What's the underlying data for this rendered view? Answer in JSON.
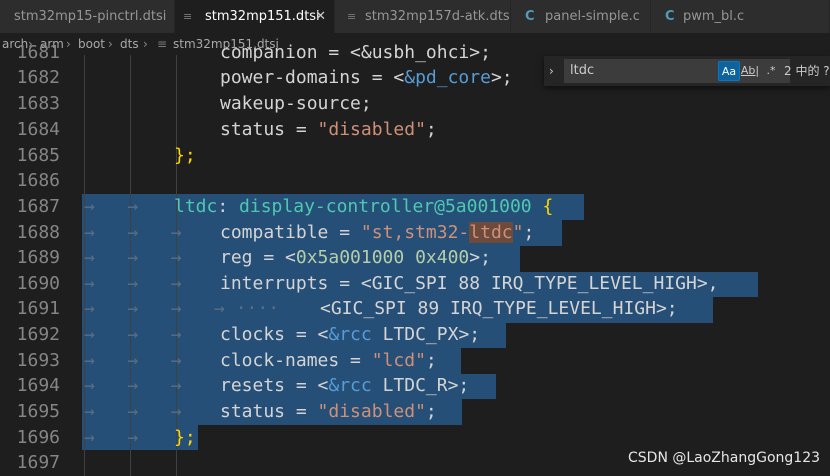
{
  "tabs": [
    {
      "label": "stm32mp15-pinctrl.dtsi",
      "icon": "file-icon",
      "active": false
    },
    {
      "label": "stm32mp151.dtsi",
      "icon": "file-icon",
      "active": true
    },
    {
      "label": "stm32mp157d-atk.dts",
      "icon": "file-icon",
      "active": false
    },
    {
      "label": "panel-simple.c",
      "icon": "c-file-icon",
      "active": false
    },
    {
      "label": "pwm_bl.c",
      "icon": "c-file-icon",
      "active": false
    }
  ],
  "breadcrumb": [
    "arch",
    "arm",
    "boot",
    "dts",
    "stm32mp151.dtsi"
  ],
  "find": {
    "query": "ltdc",
    "match_case": "Aa",
    "whole_word": "Ab|",
    "regex": ".*",
    "result": "2 中的 ?"
  },
  "watermark": "CSDN @LaoZhangGong123",
  "editor": {
    "line_numbers": [
      "1681",
      "1682",
      "1683",
      "1684",
      "1685",
      "1686",
      "1687",
      "1688",
      "1689",
      "1690",
      "1691",
      "1692",
      "1693",
      "1694",
      "1695",
      "1696",
      "1697"
    ],
    "line1681": "companion = <&usbh_ohci>;",
    "line1682": {
      "key": "power-domains = <",
      "ref": "&pd_core",
      "end": ">;"
    },
    "line1683": "wakeup-source;",
    "line1684": {
      "key": "status = ",
      "val": "\"disabled\"",
      "end": ";"
    },
    "line1685": "};",
    "line1687": {
      "label": "ltdc",
      "colon": ": ",
      "node": "display-controller@5a001000",
      "brace": "{"
    },
    "line1688": {
      "key": "compatible = ",
      "v1": "\"st,stm32-",
      "v2": "ltdc",
      "v3": "\"",
      "end": ";"
    },
    "line1689": {
      "key": "reg = <",
      "n1": "0x5a001000",
      "sp": " ",
      "n2": "0x400",
      "end": ">;"
    },
    "line1690": {
      "key": "interrupts = <",
      "p": "GIC_SPI 88 IRQ_TYPE_LEVEL_HIGH",
      "end": ">,"
    },
    "line1691": {
      "key": "<",
      "p": "GIC_SPI 89 IRQ_TYPE_LEVEL_HIGH",
      "end": ">;"
    },
    "line1692": {
      "key": "clocks = <",
      "ref": "&rcc",
      "p": " LTDC_PX",
      "end": ">;"
    },
    "line1693": {
      "key": "clock-names = ",
      "val": "\"lcd\"",
      "end": ";"
    },
    "line1694": {
      "key": "resets = <",
      "ref": "&rcc",
      "p": " LTDC_R",
      "end": ">;"
    },
    "line1695": {
      "key": "status = ",
      "val": "\"disabled\"",
      "end": ";"
    },
    "line1696": "};"
  },
  "colors": {
    "background": "#1e1e1e",
    "selection": "#264f78",
    "keyword": "#569cd6",
    "string": "#ce9178",
    "number": "#b5cea8",
    "label": "#4ec9b0",
    "brace": "#ffd700"
  }
}
